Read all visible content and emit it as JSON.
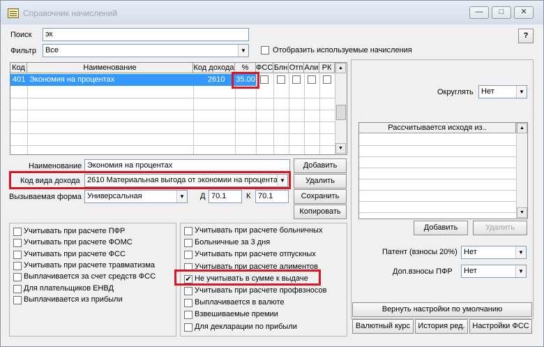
{
  "window": {
    "title": "Справочник начислений"
  },
  "search": {
    "label": "Поиск",
    "value": "эк",
    "help": "?"
  },
  "filter": {
    "label": "Фильтр",
    "value": "Все",
    "checkbox_label": "Отобразить используемые начисления"
  },
  "grid": {
    "columns": [
      "Код",
      "Наименование",
      "Код дохода",
      "%",
      "ФСС",
      "Блн",
      "Отп",
      "Али",
      "РК"
    ],
    "row": {
      "code": "401",
      "name": "Экономия на процентах",
      "income_code": "2610",
      "percent": "35.00"
    }
  },
  "form": {
    "name_label": "Наименование",
    "name_value": "Экономия на процентах",
    "income_label": "Код вида дохода",
    "income_value": "2610 Материальная выгода от экономии на процента",
    "form_label": "Вызываемая форма",
    "form_value": "Универсальная",
    "d_label": "Д",
    "d_value": "70.1",
    "k_label": "К",
    "k_value": "70.1"
  },
  "buttons": {
    "add": "Добавить",
    "delete": "Удалить",
    "save": "Сохранить",
    "copy": "Копировать"
  },
  "right": {
    "round_label": "Округлять",
    "round_value": "Нет",
    "calc_header": "Рассчитывается исходя из..",
    "add": "Добавить",
    "delete": "Удалить",
    "patent_label": "Патент (взносы 20%)",
    "patent_value": "Нет",
    "pfr_label": "Доп.взносы ПФР",
    "pfr_value": "Нет",
    "reset": "Вернуть настройки по умолчанию",
    "currency": "Валютный курс",
    "history": "История ред.",
    "fss": "Настройки ФСС"
  },
  "left_checks": [
    {
      "label": "Учитывать при расчете ПФР",
      "checked": false
    },
    {
      "label": "Учитывать при расчете ФОМС",
      "checked": false
    },
    {
      "label": "Учитывать при расчете ФСС",
      "checked": false
    },
    {
      "label": "Учитывать при расчете травматизма",
      "checked": false
    },
    {
      "label": "Выплачивается за счет средств ФСС",
      "checked": false
    },
    {
      "label": "Для плательщиков ЕНВД",
      "checked": false
    },
    {
      "label": "Выплачивается из прибыли",
      "checked": false
    }
  ],
  "mid_checks": [
    {
      "label": "Учитывать при расчете больничных",
      "checked": false
    },
    {
      "label": "Больничные за 3 дня",
      "checked": false
    },
    {
      "label": "Учитывать при расчете отпускных",
      "checked": false
    },
    {
      "label": "Учитывать при расчете алиментов",
      "checked": false
    },
    {
      "label": "Не учитывать в сумме к выдаче",
      "checked": true
    },
    {
      "label": "Учитывать при расчете профвзносов",
      "checked": false
    },
    {
      "label": "Выплачивается в валюте",
      "checked": false
    },
    {
      "label": "Взвешиваемые премии",
      "checked": false
    },
    {
      "label": "Для декларации по прибыли",
      "checked": false
    }
  ]
}
